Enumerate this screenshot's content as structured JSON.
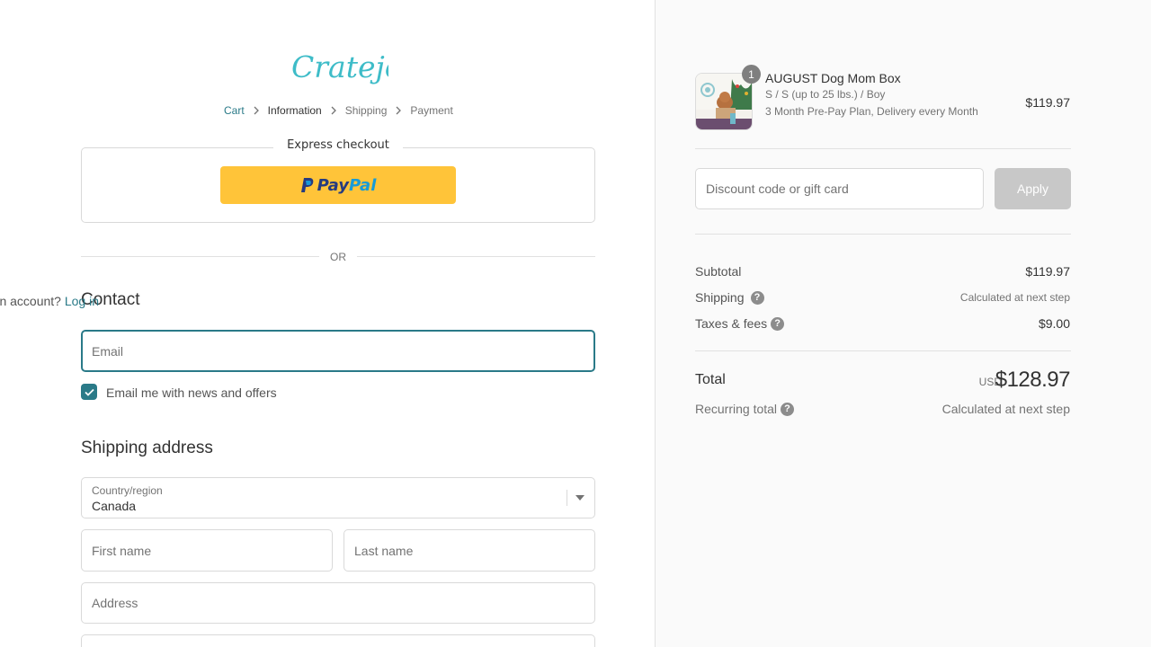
{
  "brand": {
    "logo_text": "Cratejoy",
    "accent_color": "#3ebcc8",
    "link_color": "#2a7a88"
  },
  "breadcrumb": {
    "items": [
      {
        "label": "Cart"
      },
      {
        "label": "Information"
      },
      {
        "label": "Shipping"
      },
      {
        "label": "Payment"
      }
    ]
  },
  "express": {
    "title": "Express checkout",
    "paypal_label_a": "Pay",
    "paypal_label_b": "Pal"
  },
  "divider": {
    "label": "OR"
  },
  "contact": {
    "heading": "Contact",
    "account_prompt": "Have an account?",
    "login_label": "Log in",
    "email_placeholder": "Email",
    "newsletter_label": "Email me with news and offers",
    "newsletter_checked": true
  },
  "shipping": {
    "heading": "Shipping address",
    "country_label": "Country/region",
    "country_value": "Canada",
    "first_name_placeholder": "First name",
    "last_name_placeholder": "Last name",
    "address_placeholder": "Address"
  },
  "summary": {
    "product": {
      "quantity": "1",
      "name": "AUGUST Dog Mom Box",
      "variant": "S / S (up to 25 lbs.) / Boy",
      "plan": "3 Month Pre-Pay Plan, Delivery every Month",
      "price": "$119.97"
    },
    "discount_placeholder": "Discount code or gift card",
    "apply_label": "Apply",
    "subtotal_label": "Subtotal",
    "subtotal_value": "$119.97",
    "shipping_label": "Shipping",
    "shipping_value": "Calculated at next step",
    "taxes_label": "Taxes & fees",
    "taxes_value": "$9.00",
    "total_label": "Total",
    "currency": "USD",
    "total_value": "$128.97",
    "recurring_label": "Recurring total",
    "recurring_value": "Calculated at next step"
  }
}
